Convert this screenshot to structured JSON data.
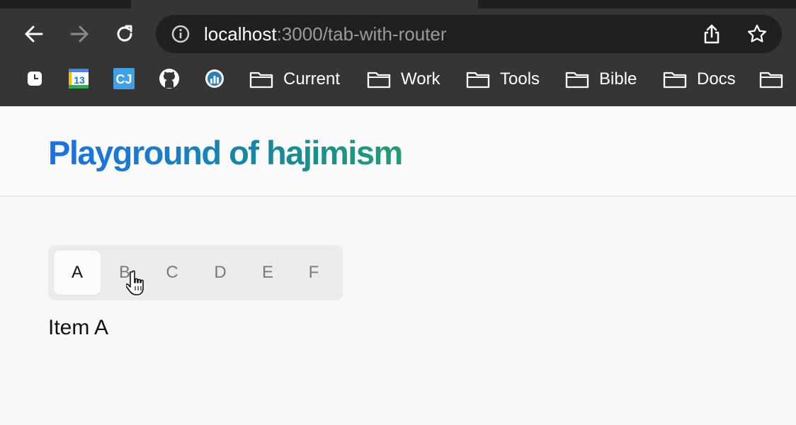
{
  "browser": {
    "url_host": "localhost",
    "url_rest": ":3000/tab-with-router",
    "icons": {
      "back": "arrow-left-icon",
      "forward": "arrow-right-icon",
      "reload": "reload-icon",
      "info": "info-icon",
      "share": "share-icon",
      "bookmark": "star-icon"
    },
    "bookmarks": [
      {
        "label": "",
        "icon": "clock-app-icon"
      },
      {
        "label": "13",
        "icon": "calendar-icon"
      },
      {
        "label": "CJ",
        "icon": "cj-icon"
      },
      {
        "label": "",
        "icon": "github-icon"
      },
      {
        "label": "",
        "icon": "chart-icon"
      },
      {
        "label": "Current",
        "icon": "folder-icon"
      },
      {
        "label": "Work",
        "icon": "folder-icon"
      },
      {
        "label": "Tools",
        "icon": "folder-icon"
      },
      {
        "label": "Bible",
        "icon": "folder-icon"
      },
      {
        "label": "Docs",
        "icon": "folder-icon"
      },
      {
        "label": "",
        "icon": "folder-icon"
      }
    ]
  },
  "page": {
    "title": "Playground of hajimism",
    "tabs": [
      "A",
      "B",
      "C",
      "D",
      "E",
      "F"
    ],
    "active_tab": "A",
    "content": "Item A"
  },
  "colors": {
    "title_gradient_start": "#1871e8",
    "title_gradient_end": "#239c73",
    "chrome_bg": "#353535"
  }
}
